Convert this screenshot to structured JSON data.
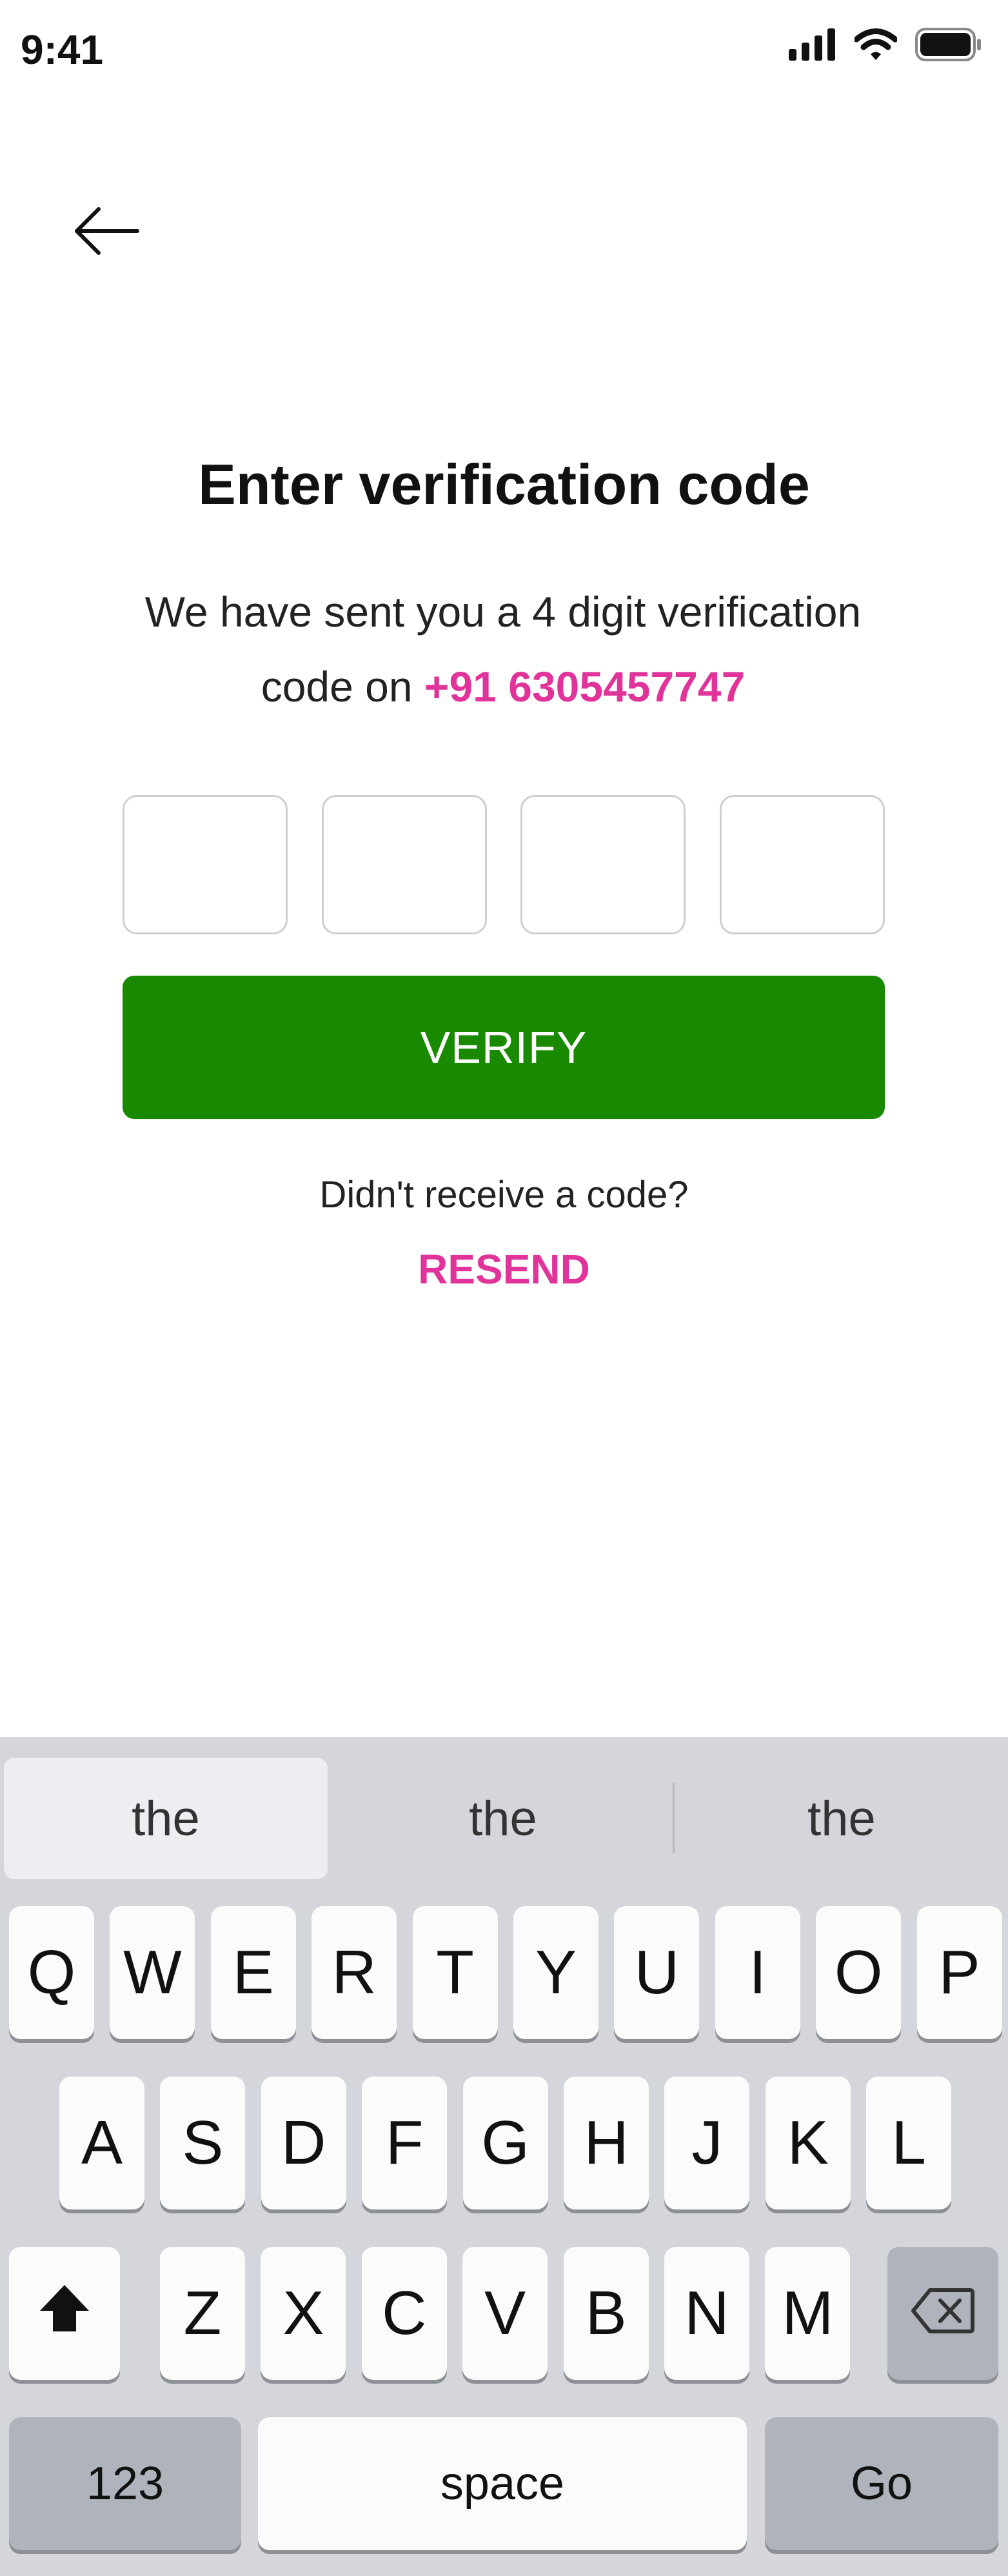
{
  "status_bar": {
    "time": "9:41",
    "icons": [
      "signal-icon",
      "wifi-icon",
      "battery-icon"
    ]
  },
  "header": {
    "back_icon": "arrow-left-icon"
  },
  "title": "Enter verification code",
  "subtitle": {
    "line1": "We have sent you a 4 digit verification",
    "line2_prefix": "code on ",
    "phone": "+91 6305457747"
  },
  "otp": {
    "digits": [
      "",
      "",
      "",
      ""
    ]
  },
  "verify_button": "VERIFY",
  "resend_prompt": "Didn't receive a code?",
  "resend_link": "RESEND",
  "colors": {
    "accent_pink": "#e0349a",
    "verify_green": "#198a00"
  },
  "keyboard": {
    "suggestions": [
      "the",
      "the",
      "the"
    ],
    "row1": [
      "Q",
      "W",
      "E",
      "R",
      "T",
      "Y",
      "U",
      "I",
      "O",
      "P"
    ],
    "row2": [
      "A",
      "S",
      "D",
      "F",
      "G",
      "H",
      "J",
      "K",
      "L"
    ],
    "row3": [
      "Z",
      "X",
      "C",
      "V",
      "B",
      "N",
      "M"
    ],
    "shift_icon": "shift-icon",
    "backspace_icon": "backspace-icon",
    "numbers_label": "123",
    "space_label": "space",
    "go_label": "Go"
  }
}
